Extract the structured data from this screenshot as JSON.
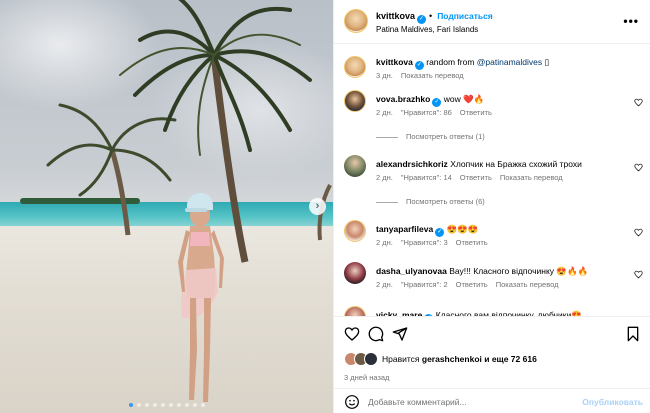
{
  "post": {
    "author": "kvittkova",
    "follow_label": "Подписаться",
    "location": "Patina Maldives, Fari Islands",
    "more_label": "•••",
    "caption": {
      "username": "kvittkova",
      "text": "random from ",
      "mention": "@patinamaldives",
      "tail": " ▯",
      "time": "3 дн.",
      "translate": "Показать перевод"
    }
  },
  "carousel": {
    "next_label": "›",
    "slide_count": 10,
    "active_slide": 0
  },
  "comments": [
    {
      "username": "vova.brazhko",
      "verified": true,
      "text": "wow ❤️🔥",
      "time": "2 дн.",
      "likes": "\"Нравится\": 86",
      "reply": "Ответить",
      "translate": "",
      "view_replies": "Посмотреть ответы (1)"
    },
    {
      "username": "alexandrsichkoriz",
      "verified": false,
      "text": "Хлопчик на Бражка схожий трохи",
      "time": "2 дн.",
      "likes": "\"Нравится\": 14",
      "reply": "Ответить",
      "translate": "Показать перевод",
      "view_replies": "Посмотреть ответы (6)"
    },
    {
      "username": "tanyaparfileva",
      "verified": true,
      "text": "😍😍😍",
      "time": "2 дн.",
      "likes": "\"Нравится\": 3",
      "reply": "Ответить",
      "translate": "",
      "view_replies": ""
    },
    {
      "username": "dasha_ulyanovaa",
      "verified": false,
      "text": "Вау!!! Класного відпочинку 😍🔥🔥",
      "time": "2 дн.",
      "likes": "\"Нравится\": 2",
      "reply": "Ответить",
      "translate": "Показать перевод",
      "view_replies": ""
    },
    {
      "username": "vicky_mare",
      "verified": true,
      "text": "Класного вам відпочинку, любчики😍",
      "time": "",
      "likes": "",
      "reply": "",
      "translate": "",
      "view_replies": ""
    }
  ],
  "actions": {
    "liked_by_prefix": "Нравится ",
    "liked_by_user": "gerashchenkoi",
    "liked_by_suffix": " и еще 72 616",
    "posted": "3 дней назад"
  },
  "add_comment": {
    "placeholder": "Добавьте комментарий...",
    "publish": "Опубликовать"
  },
  "colors": {
    "accent": "#0095f6",
    "muted": "#737373",
    "mention": "#00376b",
    "heart": "#ed4956"
  }
}
